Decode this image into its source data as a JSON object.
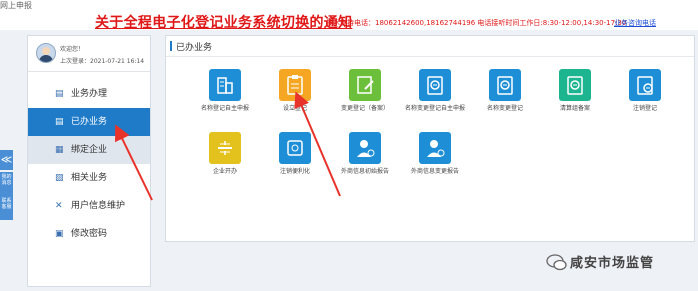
{
  "header": {
    "corner_text": "网上申报",
    "notice_title": "关于全程电子化登记业务系统切换的通知",
    "tech_support": "技术支持电话：18062142600,18162744196 电话接听时间工作日:8:30-12:00,14:30-17:30",
    "consult_link": "业务咨询电话"
  },
  "user": {
    "welcome": "欢迎您！",
    "last_login": "上次登录：2021-07-21 16:14"
  },
  "sidebar": {
    "items": [
      {
        "label": "业务办理",
        "icon": "document-icon"
      },
      {
        "label": "已办业务",
        "icon": "document-check-icon"
      },
      {
        "label": "绑定企业",
        "icon": "bind-icon"
      },
      {
        "label": "相关业务",
        "icon": "related-icon"
      },
      {
        "label": "用户信息维护",
        "icon": "wrench-icon"
      },
      {
        "label": "修改密码",
        "icon": "lock-icon"
      }
    ],
    "collapse_glyph": "≪",
    "side_btn_1": "我的消息",
    "side_btn_2": "联系客服"
  },
  "main": {
    "title": "已办业务",
    "tiles": [
      {
        "label": "名称登记自主申报",
        "icon": "building-icon",
        "color": "#1e8fd6"
      },
      {
        "label": "设立登记",
        "icon": "clipboard-icon",
        "color": "#f5a623"
      },
      {
        "label": "变更登记（备案）",
        "icon": "edit-doc-icon",
        "color": "#6cbf3a"
      },
      {
        "label": "名称变更登记自主申报",
        "icon": "doc-change-icon",
        "color": "#1e8fd6"
      },
      {
        "label": "名称变更登记",
        "icon": "doc-change-icon",
        "color": "#1e8fd6"
      },
      {
        "label": "清算组备案",
        "icon": "doc-list-icon",
        "color": "#1cb58f"
      },
      {
        "label": "注销登记",
        "icon": "doc-cancel-icon",
        "color": "#1e8fd6"
      },
      {
        "label": "企业开办",
        "icon": "open-business-icon",
        "color": "#e4c21e"
      },
      {
        "label": "注销便利化",
        "icon": "convenient-cancel-icon",
        "color": "#1e8fd6"
      },
      {
        "label": "外商信息初始报告",
        "icon": "person-report-icon",
        "color": "#1e8fd6"
      },
      {
        "label": "外商信息变更报告",
        "icon": "person-change-icon",
        "color": "#1e8fd6"
      }
    ]
  },
  "watermark": {
    "text": "咸安市场监管"
  }
}
